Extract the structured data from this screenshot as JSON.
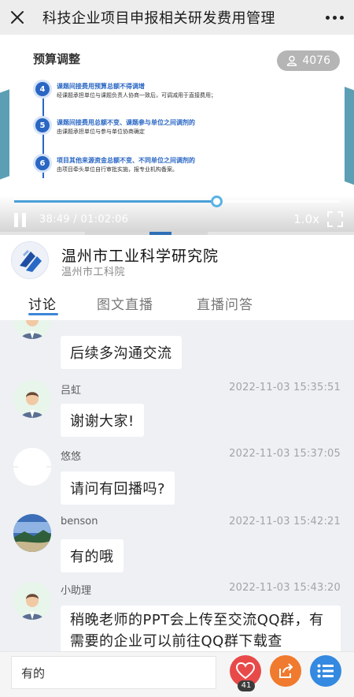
{
  "header": {
    "title": "科技企业项目申报相关研发费用管理",
    "close_icon": "close-icon",
    "more_icon": "more-dots-icon"
  },
  "video": {
    "slide_title": "预算调整",
    "viewer_count": "4076",
    "items": [
      {
        "num": "4",
        "heading": "课题间接费用预算总额不得调增",
        "desc": "经课题承担单位与课题负责人协商一致后，可调减用于直接费用；"
      },
      {
        "num": "5",
        "heading": "课题间接费用总额不变、课题参与单位之间调剂的",
        "desc": "由课题承担单位与参与单位协商确定"
      },
      {
        "num": "6",
        "heading": "项目其他来源资金总额不变、不同单位之间调剂的",
        "desc": "由项目牵头单位自行审批实施，报专业机构备案。"
      }
    ],
    "time_display": "38:49 / 01:02:06",
    "speed": "1.0x",
    "progress": 0.62,
    "colors": {
      "accent": "#2a67c4",
      "progress": "#4aa0d8"
    }
  },
  "org": {
    "name": "温州市工业科学研究院",
    "short_name": "温州市工科院"
  },
  "tabs": [
    {
      "label": "讨论",
      "active": true
    },
    {
      "label": "图文直播",
      "active": false
    },
    {
      "label": "直播问答",
      "active": false
    }
  ],
  "messages": [
    {
      "name": "",
      "time": "",
      "text": "后续多沟通交流",
      "avatar": "default-avatar"
    },
    {
      "name": "吕虹",
      "time": "2022-11-03 15:35:51",
      "text": "谢谢大家!",
      "avatar": "default-avatar"
    },
    {
      "name": "悠悠",
      "time": "2022-11-03 15:37:05",
      "text": "请问有回播吗?",
      "avatar": "blank-avatar"
    },
    {
      "name": "benson",
      "time": "2022-11-03 15:42:21",
      "text": "有的哦",
      "avatar": "landscape-avatar"
    },
    {
      "name": "小助理",
      "time": "2022-11-03 15:43:20",
      "text": "稍晚老师的PPT会上传至交流QQ群，有需要的企业可以前往QQ群下载查",
      "avatar": "default-avatar"
    }
  ],
  "composer": {
    "input_value": "有的",
    "like_count": "41"
  }
}
